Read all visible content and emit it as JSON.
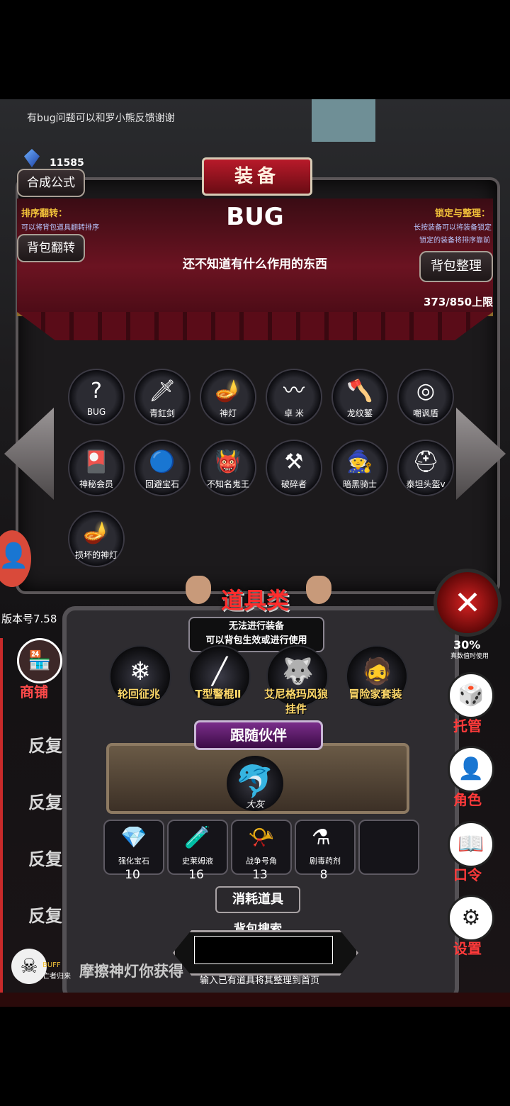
{
  "top_note": "有bug问题可以和罗小熊反馈谢谢",
  "gems": "11585",
  "panel": {
    "title": "装备",
    "formula_button": "合成公式",
    "sort_title": "排序翻转：",
    "sort_desc": "可以将背包道具翻转排序",
    "flip_button": "背包翻转",
    "lock_title": "锁定与整理：",
    "lock_desc1": "长按装备可以将装备锁定",
    "lock_desc2": "锁定的装备将排序靠前",
    "tidy_button": "背包整理",
    "selected_name": "BUG",
    "selected_desc": "还不知道有什么作用的东西",
    "capacity": "373/850上限"
  },
  "items": [
    {
      "name": "BUG",
      "icon": "bug-icon",
      "glyph": "?"
    },
    {
      "name": "青釭剑",
      "icon": "sword-icon",
      "glyph": "🗡"
    },
    {
      "name": "神灯",
      "icon": "lamp-icon",
      "glyph": "🪔"
    },
    {
      "name": "卓 米",
      "icon": "whip-icon",
      "glyph": "〰"
    },
    {
      "name": "龙纹錾",
      "icon": "axe-icon",
      "glyph": "🪓"
    },
    {
      "name": "嘲讽盾",
      "icon": "shield-icon",
      "glyph": "◎"
    },
    {
      "name": "神秘会员",
      "icon": "card-icon",
      "glyph": "🎴"
    },
    {
      "name": "回避宝石",
      "icon": "gem-icon",
      "glyph": "🔵"
    },
    {
      "name": "不知名鬼王",
      "icon": "ghost-king-icon",
      "glyph": "👹"
    },
    {
      "name": "破碎者",
      "icon": "mace-icon",
      "glyph": "⚒"
    },
    {
      "name": "暗黑骑士",
      "icon": "dark-knight-icon",
      "glyph": "🧙"
    },
    {
      "name": "泰坦头盔v",
      "icon": "helmet-icon",
      "glyph": "⛑"
    },
    {
      "name": "损坏的神灯",
      "icon": "broken-lamp-icon",
      "glyph": "🪔"
    }
  ],
  "tools": {
    "title": "道具类",
    "desc1": "无法进行装备",
    "desc2": "可以背包生效或进行使用",
    "list": [
      {
        "name": "轮回征兆",
        "icon": "staff-icon",
        "glyph": "❄"
      },
      {
        "name": "T型警棍Ⅱ",
        "icon": "baton-icon",
        "glyph": "╱"
      },
      {
        "name": "艾尼格玛风狼挂件",
        "icon": "wolf-pendant-icon",
        "glyph": "🐺"
      },
      {
        "name": "冒险家套装",
        "icon": "adventurer-icon",
        "glyph": "🧔"
      }
    ],
    "follow_title": "跟随伙伴",
    "pet_name": "大灰",
    "consumables": [
      {
        "name": "强化宝石",
        "count": "10",
        "icon": "upgrade-gem-icon",
        "glyph": "💎"
      },
      {
        "name": "史莱姆液",
        "count": "16",
        "icon": "slime-potion-icon",
        "glyph": "🧪"
      },
      {
        "name": "战争号角",
        "count": "13",
        "icon": "war-horn-icon",
        "glyph": "📯"
      },
      {
        "name": "剧毒药剂",
        "count": "8",
        "icon": "poison-icon",
        "glyph": "⚗"
      },
      {
        "name": "",
        "count": "",
        "icon": "empty-slot",
        "glyph": ""
      }
    ],
    "consumable_title": "消耗道具",
    "search_title": "背包搜索",
    "search_value": "",
    "search_hint": "输入已有道具将其整理到首页"
  },
  "left": {
    "version": "版本号7.58",
    "shop": "商铺",
    "repeat": [
      "反复",
      "反复",
      "反复",
      "反复"
    ],
    "buff": "BUFF",
    "buff_sub": "亡者归来",
    "marquee": "摩擦神灯你获得"
  },
  "right": {
    "stat": "30%",
    "stat_sub": "真数值时使用",
    "buttons": [
      {
        "label": "托管",
        "icon": "dice-icon",
        "glyph": "🎲"
      },
      {
        "label": "角色",
        "icon": "character-icon",
        "glyph": "👤"
      },
      {
        "label": "口令",
        "icon": "code-icon",
        "glyph": "📖"
      },
      {
        "label": "设置",
        "icon": "gear-icon",
        "glyph": "⚙"
      }
    ]
  }
}
